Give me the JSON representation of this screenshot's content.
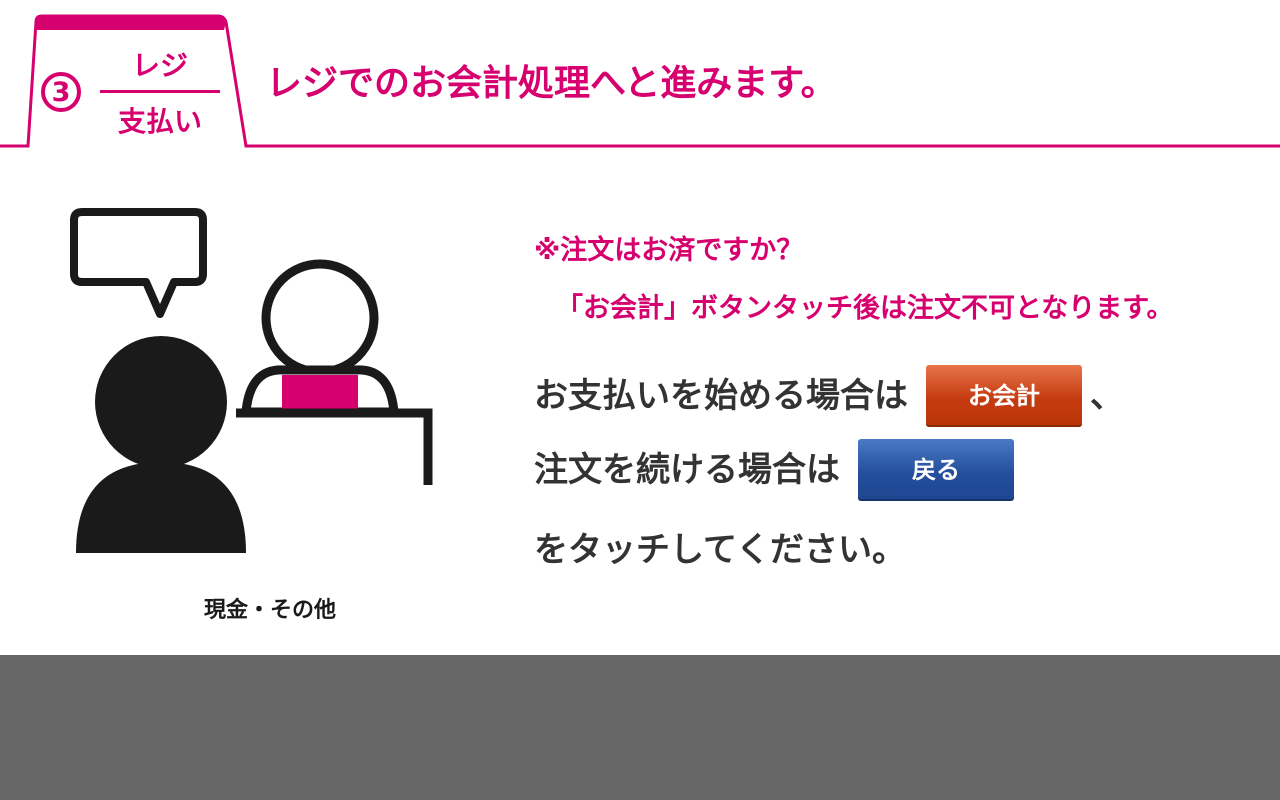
{
  "header": {
    "step_number": "3",
    "step_top": "レジ",
    "step_bottom": "支払い",
    "title": "レジでのお会計処理へと進みます。",
    "accent_color": "#d6006f"
  },
  "illustration": {
    "caption": "現金・その他"
  },
  "notice": {
    "line1": "※注文はお済ですか？",
    "line2": "「お会計」ボタンタッチ後は注文不可となります。"
  },
  "instructions": {
    "line1_prefix": "お支払いを始める場合は",
    "pay_button_label": "お会計",
    "line1_suffix": "、",
    "line2_prefix": "注文を続ける場合は",
    "back_button_label": "戻る",
    "line3": "をタッチしてください。"
  },
  "colors": {
    "pay_button": "#c53b10",
    "back_button": "#244f9c",
    "footer": "#666666"
  }
}
